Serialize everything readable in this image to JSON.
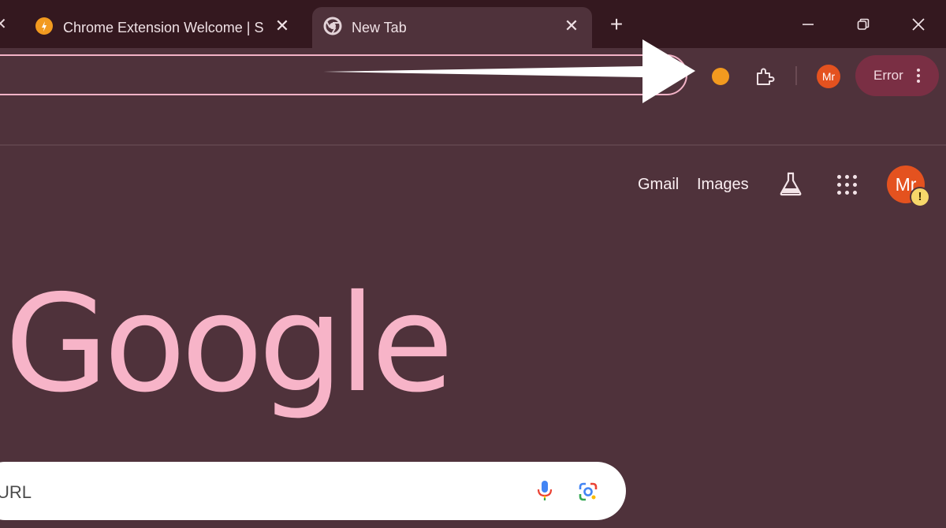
{
  "tabs": [
    {
      "title": "Chrome Extension Welcome | Sl",
      "active": false,
      "icon": "extension-favicon"
    },
    {
      "title": "New Tab",
      "active": true,
      "icon": "chrome-icon"
    }
  ],
  "toolbar": {
    "profile_initials": "Mr",
    "error_label": "Error"
  },
  "ntp": {
    "links": [
      "Gmail",
      "Images"
    ],
    "profile_initials": "Mr",
    "warning_badge": "!",
    "logo_text": "Google",
    "search_placeholder": "URL"
  },
  "colors": {
    "background": "#4f323b",
    "tabstrip": "#34181f",
    "accent_pink": "#f7b4c8",
    "error_chip": "#7a2f44",
    "avatar": "#e4521f"
  }
}
